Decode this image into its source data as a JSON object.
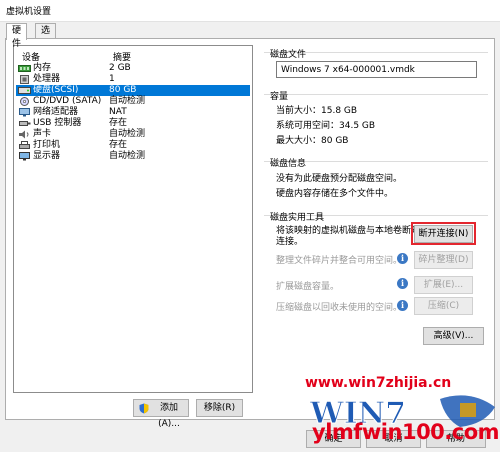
{
  "window": {
    "title": "虚拟机设置"
  },
  "tabs": [
    {
      "label": "硬件"
    },
    {
      "label": "选项"
    }
  ],
  "device_list": {
    "header": {
      "device": "设备",
      "summary": "摘要"
    },
    "items": [
      {
        "name": "内存",
        "summary": "2 GB",
        "icon": "memory-icon"
      },
      {
        "name": "处理器",
        "summary": "1",
        "icon": "cpu-icon"
      },
      {
        "name": "硬盘(SCSI)",
        "summary": "80 GB",
        "icon": "hard-disk-icon",
        "selected": true
      },
      {
        "name": "CD/DVD (SATA)",
        "summary": "自动检测",
        "icon": "cd-dvd-icon"
      },
      {
        "name": "网络适配器",
        "summary": "NAT",
        "icon": "network-adapter-icon"
      },
      {
        "name": "USB 控制器",
        "summary": "存在",
        "icon": "usb-icon"
      },
      {
        "name": "声卡",
        "summary": "自动检测",
        "icon": "sound-card-icon"
      },
      {
        "name": "打印机",
        "summary": "存在",
        "icon": "printer-icon"
      },
      {
        "name": "显示器",
        "summary": "自动检测",
        "icon": "display-icon"
      }
    ],
    "add_button": "添加(A)...",
    "remove_button": "移除(R)"
  },
  "disk_file": {
    "title": "磁盘文件",
    "value": "Windows 7 x64-000001.vmdk"
  },
  "capacity": {
    "title": "容量",
    "current_size": "当前大小：15.8 GB",
    "system_free": "系统可用空间：34.5 GB",
    "max_size": "最大大小：80 GB"
  },
  "disk_info": {
    "title": "磁盘信息",
    "line1": "没有为此硬盘预分配磁盘空间。",
    "line2": "硬盘内容存储在多个文件中。"
  },
  "disk_utilities": {
    "title": "磁盘实用工具",
    "disconnect_desc_1": "将该映射的虚拟机磁盘与本地卷断开",
    "disconnect_desc_2": "连接。",
    "disconnect_button": "断开连接(N)",
    "defrag_desc": "整理文件碎片并整合可用空间。",
    "defrag_button": "碎片整理(D)",
    "expand_desc": "扩展磁盘容量。",
    "expand_button": "扩展(E)...",
    "compact_desc": "压缩磁盘以回收未使用的空间。",
    "compact_button": "压缩(C)"
  },
  "advanced_button": "高级(V)...",
  "footer": {
    "ok": "确定",
    "cancel": "取消",
    "help": "帮助"
  },
  "watermarks": {
    "top": "www.win7zhijia.cn",
    "logo_text": "WIN7",
    "bottom": "ylmfwin100.com"
  },
  "colors": {
    "selection": "#0078d7",
    "highlight_box": "#e3262e",
    "watermark": "#e2001a"
  }
}
